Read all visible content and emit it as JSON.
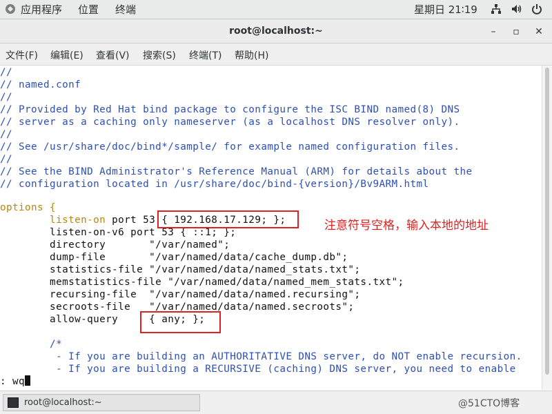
{
  "top_panel": {
    "apps": "应用程序",
    "places": "位置",
    "terminal": "终端",
    "clock": "星期日 21∶19",
    "icons": [
      "network-icon",
      "volume-icon",
      "power-icon"
    ]
  },
  "window": {
    "title": "root@localhost:~",
    "minimize_glyph": "–",
    "maximize_glyph": "▫",
    "close_glyph": "✕"
  },
  "menu": {
    "file": "文件(F)",
    "edit": "编辑(E)",
    "view": "查看(V)",
    "search": "搜索(S)",
    "terminal": "终端(T)",
    "help": "帮助(H)"
  },
  "terminal": {
    "lines": [
      {
        "type": "comment",
        "text": "//"
      },
      {
        "type": "comment",
        "text": "// named.conf"
      },
      {
        "type": "comment",
        "text": "//"
      },
      {
        "type": "comment",
        "text": "// Provided by Red Hat bind package to configure the ISC BIND named(8) DNS"
      },
      {
        "type": "comment",
        "text": "// server as a caching only nameserver (as a localhost DNS resolver only)."
      },
      {
        "type": "comment",
        "text": "//"
      },
      {
        "type": "comment",
        "text": "// See /usr/share/doc/bind*/sample/ for example named configuration files."
      },
      {
        "type": "comment",
        "text": "//"
      },
      {
        "type": "comment",
        "text": "// See the BIND Administrator's Reference Manual (ARM) for details about the"
      },
      {
        "type": "comment",
        "text": "// configuration located in /usr/share/doc/bind-{version}/Bv9ARM.html"
      },
      {
        "type": "blank",
        "text": ""
      },
      {
        "type": "keyword",
        "text": "options {"
      },
      {
        "type": "code",
        "kw": "        listen-on",
        "rest": " port 53 { 192.168.17.129; };"
      },
      {
        "type": "code",
        "kw": "        listen-on-v6 port 53 { ::1; };",
        "rest": ""
      },
      {
        "type": "code",
        "kw": "        directory       \"/var/named\";",
        "rest": ""
      },
      {
        "type": "code",
        "kw": "        dump-file       \"/var/named/data/cache_dump.db\";",
        "rest": ""
      },
      {
        "type": "code",
        "kw": "        statistics-file \"/var/named/data/named_stats.txt\";",
        "rest": ""
      },
      {
        "type": "code",
        "kw": "        memstatistics-file \"/var/named/data/named_mem_stats.txt\";",
        "rest": ""
      },
      {
        "type": "code",
        "kw": "        recursing-file  \"/var/named/data/named.recursing\";",
        "rest": ""
      },
      {
        "type": "code",
        "kw": "        secroots-file   \"/var/named/data/named.secroots\";",
        "rest": ""
      },
      {
        "type": "code",
        "kw": "        allow-query     { any; };",
        "rest": ""
      },
      {
        "type": "blank",
        "text": ""
      },
      {
        "type": "comment",
        "text": "        /*"
      },
      {
        "type": "comment",
        "text": "         - If you are building an AUTHORITATIVE DNS server, do NOT enable recursion."
      },
      {
        "type": "comment",
        "text": "         - If you are building a RECURSIVE (caching) DNS server, you need to enable"
      }
    ],
    "command_line": ": wq"
  },
  "annotation": "注意符号空格，输入本地的地址",
  "taskbar": {
    "task_label": "root@localhost:~"
  },
  "watermark": "@51CTO博客",
  "colors": {
    "comment": "#2d4fb5",
    "keyword": "#b8860b",
    "highlight_box": "#e02020"
  }
}
